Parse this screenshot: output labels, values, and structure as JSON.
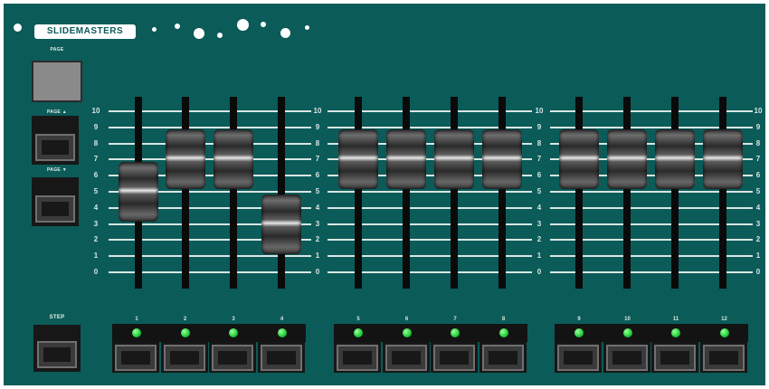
{
  "brand": {
    "logo_text": "SLIDEMASTERS"
  },
  "controls": {
    "page_label": "PAGE",
    "page_up_label": "PAGE ▲",
    "page_down_label": "PAGE ▼",
    "step_label": "STEP"
  },
  "scale": {
    "labels": [
      "10",
      "9",
      "8",
      "7",
      "6",
      "5",
      "4",
      "3",
      "2",
      "1",
      "0"
    ]
  },
  "channels": [
    {
      "number": "1",
      "fader_level": 5
    },
    {
      "number": "2",
      "fader_level": 7
    },
    {
      "number": "3",
      "fader_level": 7
    },
    {
      "number": "4",
      "fader_level": 3
    },
    {
      "number": "5",
      "fader_level": 7
    },
    {
      "number": "6",
      "fader_level": 7
    },
    {
      "number": "7",
      "fader_level": 7
    },
    {
      "number": "8",
      "fader_level": 7
    },
    {
      "number": "9",
      "fader_level": 7
    },
    {
      "number": "10",
      "fader_level": 7
    },
    {
      "number": "11",
      "fader_level": 7
    },
    {
      "number": "12",
      "fader_level": 7
    }
  ],
  "colors": {
    "panel": "#0b5b59",
    "led": "#1fcc3a"
  }
}
